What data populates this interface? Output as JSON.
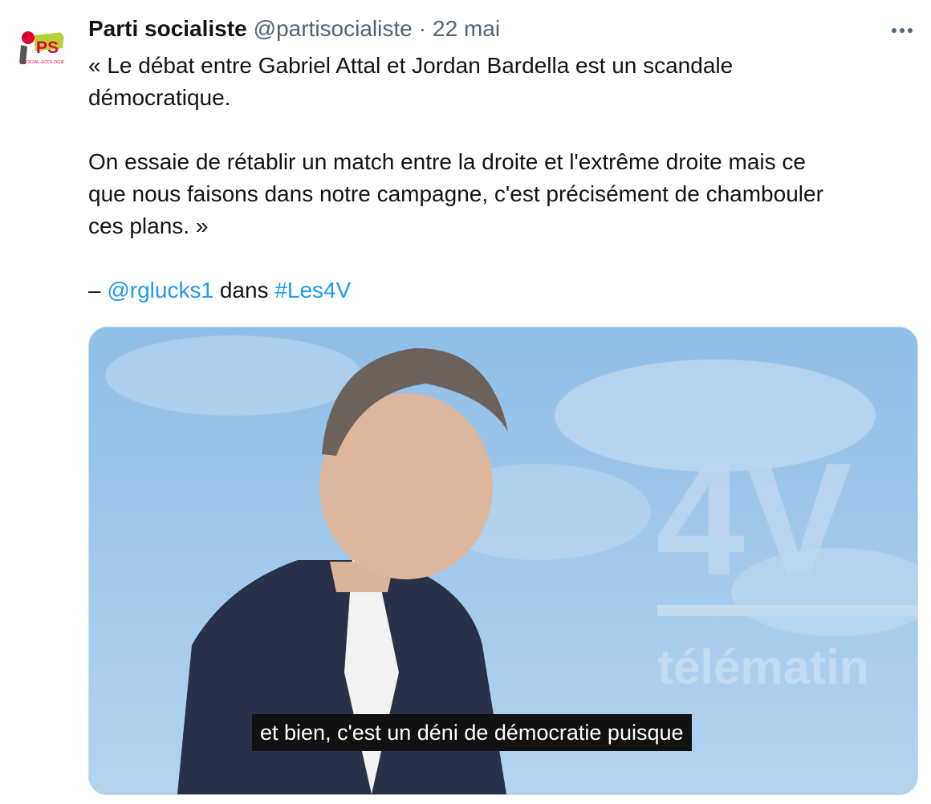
{
  "post": {
    "author_name": "Parti socialiste",
    "author_handle": "@partisocialiste",
    "separator": "·",
    "date": "22 mai",
    "avatar": {
      "logo_text": "PS",
      "logo_subtext": "SOCIAL·ÉCOLOGIE"
    },
    "more_icon": "more-horizontal-icon",
    "text": {
      "quote_line_1": "« Le débat entre Gabriel Attal et Jordan Bardella est un scandale",
      "quote_line_2": "démocratique.",
      "para_2_line_1": "On essaie de rétablir un match entre la droite et l'extrême droite mais ce",
      "para_2_line_2": "que nous faisons dans notre campagne, c'est précisément de chambouler",
      "para_2_line_3": "ces plans. »",
      "credit_prefix": "– ",
      "mention": "@rglucks1",
      "credit_middle": " dans ",
      "hashtag": "#Les4V"
    },
    "media": {
      "background_logo": "4V",
      "background_subtitle": "télématin",
      "caption": "et bien, c'est un déni de démocratie puisque"
    }
  },
  "colors": {
    "link": "#1d9bf0",
    "secondary_text": "#536471",
    "logo_red": "#e4003b",
    "logo_green": "#b2d235",
    "studio_blue": "#9bc6ea"
  }
}
